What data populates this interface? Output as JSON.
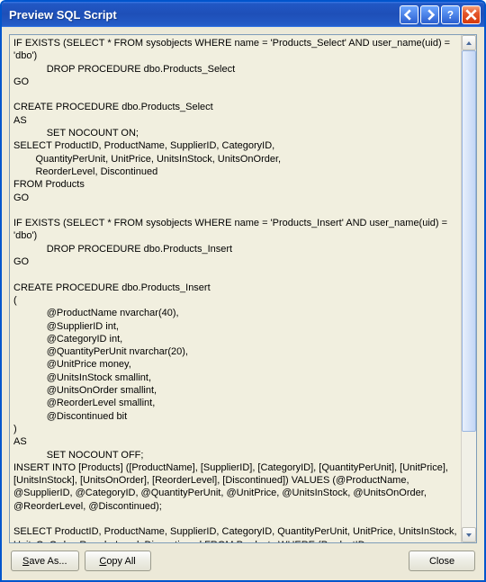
{
  "window": {
    "title": "Preview SQL Script"
  },
  "buttons": {
    "save_as": "Save As...",
    "copy_all": "Copy All",
    "close": "Close"
  },
  "script": "IF EXISTS (SELECT * FROM sysobjects WHERE name = 'Products_Select' AND user_name(uid) = 'dbo')\n            DROP PROCEDURE dbo.Products_Select\nGO\n\nCREATE PROCEDURE dbo.Products_Select\nAS\n            SET NOCOUNT ON;\nSELECT ProductID, ProductName, SupplierID, CategoryID,\n        QuantityPerUnit, UnitPrice, UnitsInStock, UnitsOnOrder,\n        ReorderLevel, Discontinued\nFROM Products\nGO\n\nIF EXISTS (SELECT * FROM sysobjects WHERE name = 'Products_Insert' AND user_name(uid) = 'dbo')\n            DROP PROCEDURE dbo.Products_Insert\nGO\n\nCREATE PROCEDURE dbo.Products_Insert\n(\n            @ProductName nvarchar(40),\n            @SupplierID int,\n            @CategoryID int,\n            @QuantityPerUnit nvarchar(20),\n            @UnitPrice money,\n            @UnitsInStock smallint,\n            @UnitsOnOrder smallint,\n            @ReorderLevel smallint,\n            @Discontinued bit\n)\nAS\n            SET NOCOUNT OFF;\nINSERT INTO [Products] ([ProductName], [SupplierID], [CategoryID], [QuantityPerUnit], [UnitPrice], [UnitsInStock], [UnitsOnOrder], [ReorderLevel], [Discontinued]) VALUES (@ProductName, @SupplierID, @CategoryID, @QuantityPerUnit, @UnitPrice, @UnitsInStock, @UnitsOnOrder, @ReorderLevel, @Discontinued);\n\nSELECT ProductID, ProductName, SupplierID, CategoryID, QuantityPerUnit, UnitPrice, UnitsInStock, UnitsOnOrder, ReorderLevel, Discontinued FROM Products WHERE (ProductID = SCOPE_IDENTITY())\nGO"
}
